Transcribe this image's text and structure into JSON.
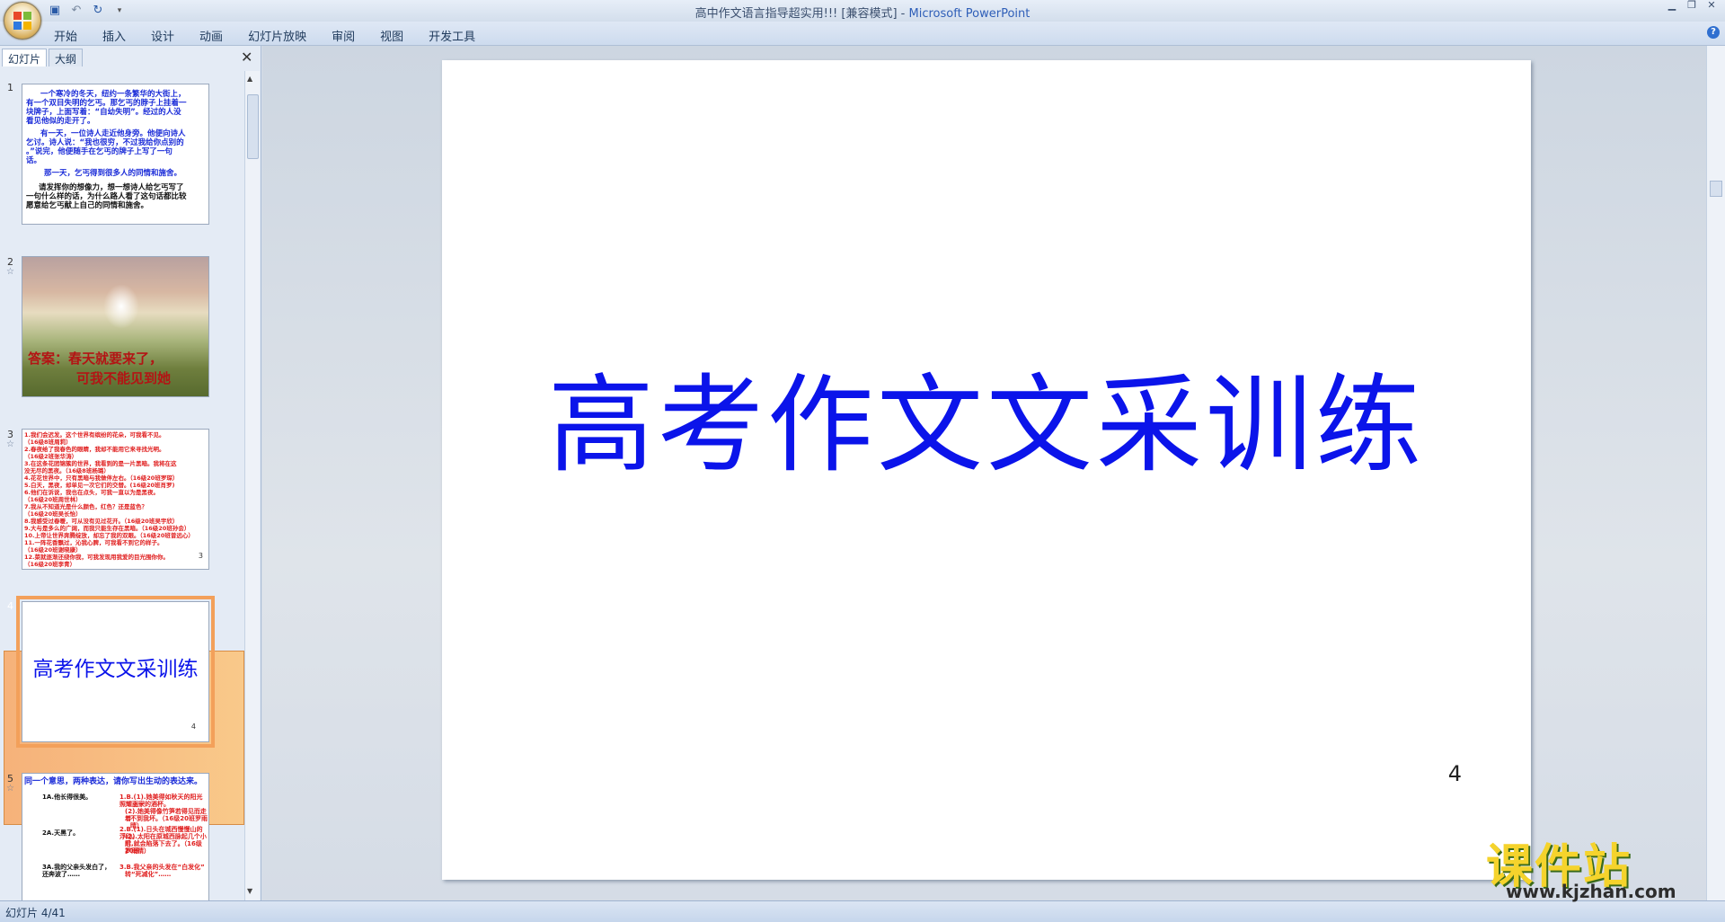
{
  "window": {
    "title": "高中作文语言指导超实用!!! [兼容模式] - ",
    "app_name": "Microsoft PowerPoint"
  },
  "quick_access": {
    "save_icon": "save-icon",
    "undo_icon": "undo-icon",
    "redo_icon": "redo-icon"
  },
  "ribbon_tabs": [
    "开始",
    "插入",
    "设计",
    "动画",
    "幻灯片放映",
    "审阅",
    "视图",
    "开发工具"
  ],
  "panel": {
    "tab_slides": "幻灯片",
    "tab_outline": "大纲",
    "close": "✕"
  },
  "thumbnails": {
    "s1": {
      "num": "1",
      "lines": [
        "一个寒冷的冬天，纽约一条繁华的大街上，",
        "有一个双目失明的乞丐。那乞丐的脖子上挂着一",
        "块牌子，上面写着：“自幼失明”。经过的人没",
        "看见他似的走开了。",
        "有一天，一位诗人走近他身旁。他便向诗人",
        "乞讨。诗人说：“我也很穷，不过我给你点别的",
        "。”说完，他便随手在乞丐的牌子上写了一句",
        "话。",
        "那一天，乞丐得到很多人的同情和施舍。",
        "请发挥你的想像力，想一想诗人给乞丐写了",
        "一句什么样的话，为什么路人看了这句话都比较",
        "愿意给乞丐献上自己的同情和施舍。"
      ]
    },
    "s2": {
      "num": "2",
      "line1": "答案：春天就要来了，",
      "line2": "可我不能见到她"
    },
    "s3": {
      "num": "3",
      "lines": [
        "1.我们会迟发。这个世界有缤纷的花朵，可我看不见。",
        "（16级8班周莉）",
        "2.春夜给了我春色的眼睛，我却不能用它来寻找光明。",
        "（16级2班张华涛）",
        "3.在这条花团锦簇的世界，我看到的是一片黑暗。我将在这",
        "没无尽的黑夜。（16级8班杨璐）",
        "4.花花世界中，只有黑暗与我做伴左右。（16级20班罗琛）",
        "5.白天，黑夜，却单见一次它们的交替。(16级20班肖罗)",
        "6.他们在诉说，我也在点头，可我一直以为是黑夜。",
        "（16级20班周世林）",
        "7.我从不知道光是什么颜色，红色？还是蓝色？",
        "（16级20班吴长怡）",
        "8.我感受过春暖，可从没有见过花开。（16级20班吴宇欣）",
        "9.大与是多么的广阔，而我只能生存在黑暗。（16级20班孙会）",
        "10.上帝让世界奔腾绽放，却忘了我的双眼。（16级20班曾远心）",
        "11.一阵花香飘过，沁我心脾，可我看不到它的样子。",
        "（16级20班谢晓康）",
        "12.菜就逐渐还绕你我，可我发现用我爱的目光围你你。",
        "（16级20班李青）"
      ],
      "page": "3"
    },
    "s4": {
      "num": "4",
      "title": "高考作文文采训练",
      "page": "4"
    },
    "s5": {
      "num": "5",
      "header": "同一个意思，两种表达，请你写出生动的表达来。",
      "items": [
        {
          "left": "1A.他长得很美。",
          "right": [
            "1.B.(1).她美得如秋天的阳光照耀上一",
            "丽家的酒杯。",
            "(2).她美得像竹笋若得见而走着",
            "不到我坏。（16级20班罗雨晴）"
          ]
        },
        {
          "left": "2A.天黑了。",
          "right": [
            "2.B.(1).日头在城西慢慢山的浮动。",
            "(2).太阳在原城西脉起几个小时",
            "后,就会陷落下去了。（16级20班",
            "罗雨晴）"
          ]
        },
        {
          "left": "3A.我的父亲头发白了，还奔波了……",
          "right": [
            "3.B.我父亲的头发在“白发化”",
            "转“死减化”……"
          ]
        }
      ]
    }
  },
  "slide": {
    "title": "高考作文文采训练",
    "page_number": "4"
  },
  "status": {
    "slide_info": "幻灯片 4/41"
  },
  "watermark": {
    "name": "课件站",
    "url": "www.kjzhan.com"
  },
  "colors": {
    "title_blue": "#0b14ea",
    "accent_orange": "#f3a05a",
    "thumb_red": "#e02020"
  }
}
